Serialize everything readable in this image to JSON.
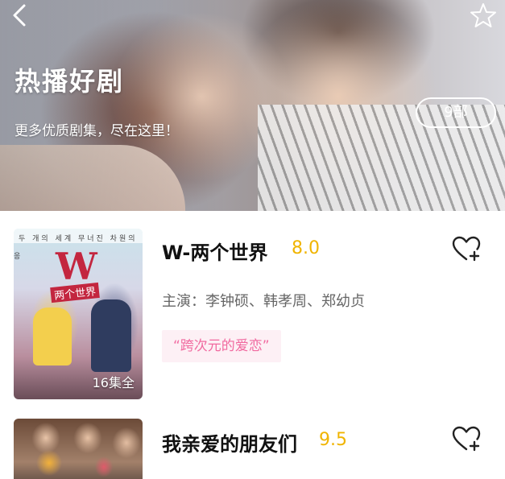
{
  "header": {
    "title": "热播好剧",
    "subtitle": "更多优质剧集，尽在这里！",
    "count_badge": "9部",
    "back_icon": "chevron-left-icon",
    "favorite_icon": "star-outline-icon"
  },
  "poster_texts": {
    "w_top_line": "두 개의 세계 무너진 차원의 응",
    "w_logo": "W",
    "w_subtitle": "两个世界"
  },
  "dramas": [
    {
      "title": "W-两个世界",
      "score": "8.0",
      "cast": "主演：李钟硕、韩孝周、郑幼贞",
      "tag": "“跨次元的爱恋”",
      "episodes": "16集全",
      "fav_icon": "heart-plus-icon"
    },
    {
      "title": "我亲爱的朋友们",
      "score": "9.5",
      "fav_icon": "heart-plus-icon"
    }
  ],
  "colors": {
    "score": "#f0b400",
    "tag_text": "#f16aa0",
    "tag_bg": "#fdf0f5"
  }
}
